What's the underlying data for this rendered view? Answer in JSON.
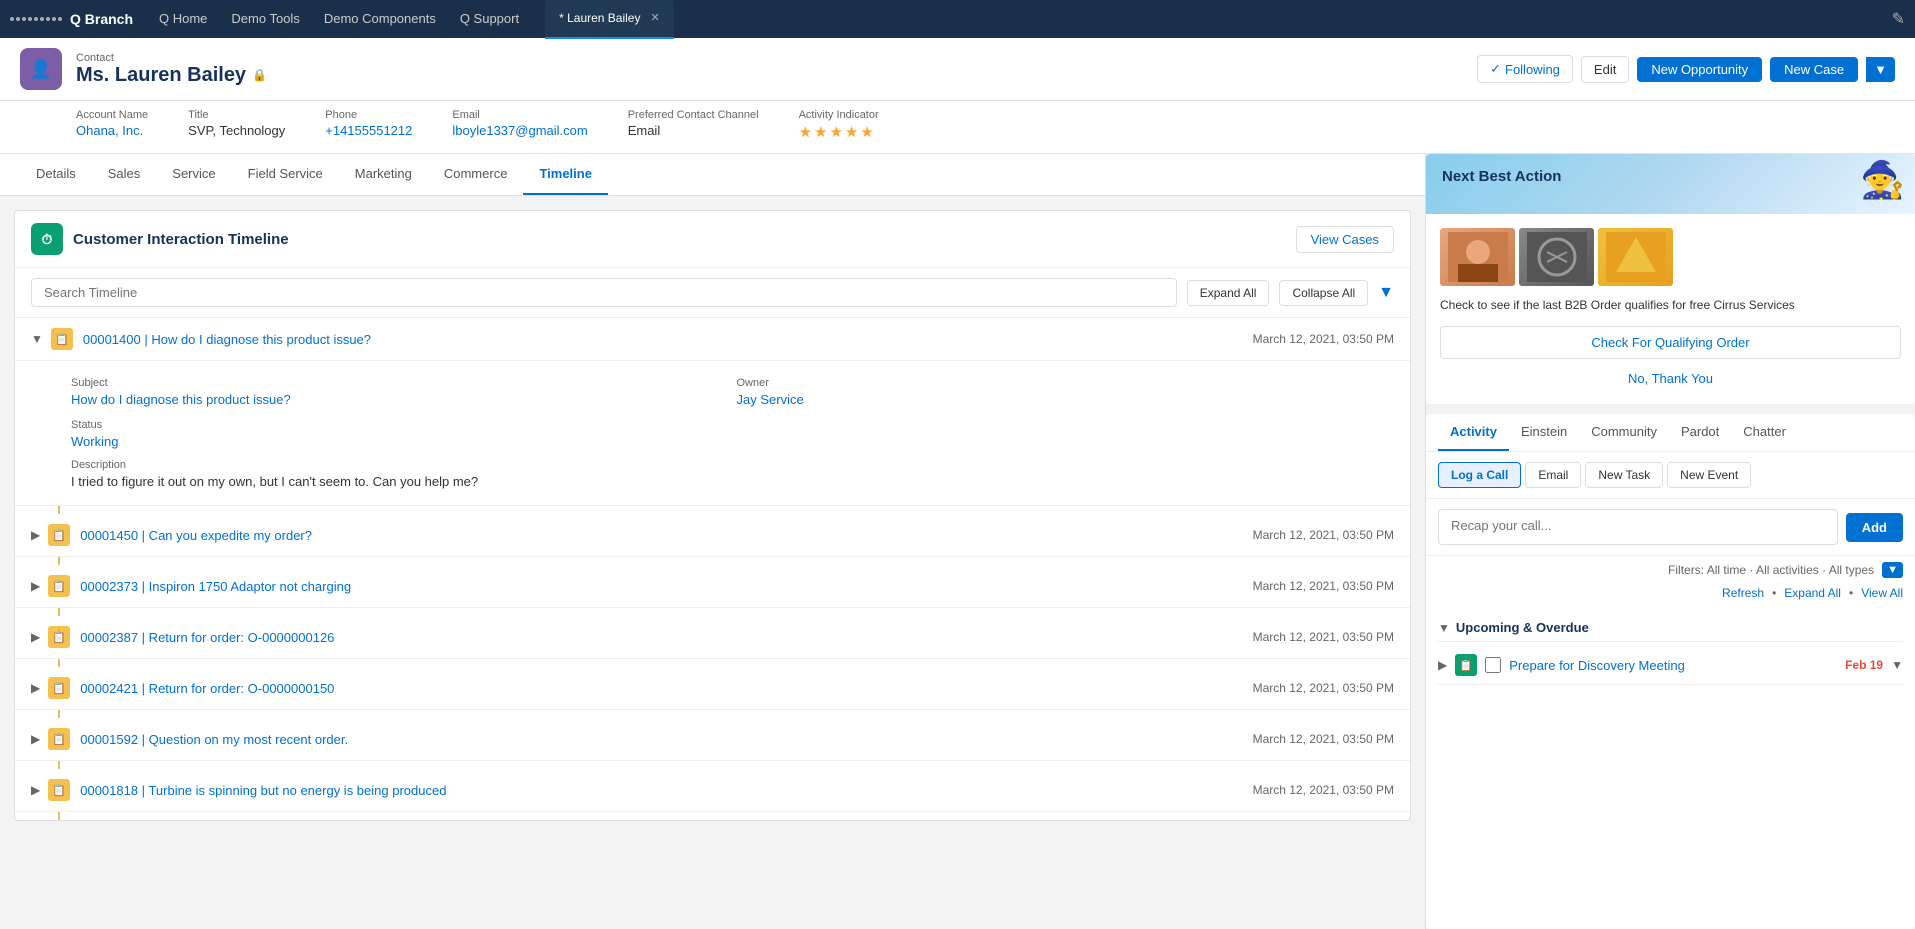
{
  "topNav": {
    "appName": "Q Branch",
    "links": [
      "Q Home",
      "Demo Tools",
      "Demo Components",
      "Q Support"
    ],
    "activeTab": "* Lauren Bailey",
    "tabs": [
      {
        "label": "* Lauren Bailey",
        "active": true
      }
    ]
  },
  "header": {
    "recordType": "Contact",
    "name": "Ms. Lauren Bailey",
    "followLabel": "Following",
    "editLabel": "Edit",
    "newOpportunityLabel": "New Opportunity",
    "newCaseLabel": "New Case"
  },
  "subheader": {
    "accountNameLabel": "Account Name",
    "accountNameValue": "Ohana, Inc.",
    "titleLabel": "Title",
    "titleValue": "SVP, Technology",
    "phoneLabel": "Phone",
    "phoneValue": "+14155551212",
    "emailLabel": "Email",
    "emailValue": "lboyle1337@gmail.com",
    "preferredContactLabel": "Preferred Contact Channel",
    "preferredContactValue": "Email",
    "activityIndicatorLabel": "Activity Indicator",
    "stars": "★★★★★"
  },
  "tabs": {
    "items": [
      "Details",
      "Sales",
      "Service",
      "Field Service",
      "Marketing",
      "Commerce",
      "Timeline"
    ],
    "activeIndex": 6
  },
  "timeline": {
    "title": "Customer Interaction Timeline",
    "viewCasesLabel": "View Cases",
    "searchPlaceholder": "Search Timeline",
    "expandAllLabel": "Expand All",
    "collapseAllLabel": "Collapse All",
    "cases": [
      {
        "id": "00001400",
        "title": "How do I diagnose this product issue?",
        "date": "March 12, 2021, 03:50 PM",
        "expanded": true,
        "subject": "How do I diagnose this product issue?",
        "owner": "Jay Service",
        "status": "Working",
        "description": "I tried to figure it out on my own, but I can't seem to. Can you help me?"
      },
      {
        "id": "00001450",
        "title": "Can you expedite my order?",
        "date": "March 12, 2021, 03:50 PM",
        "expanded": false
      },
      {
        "id": "00002373",
        "title": "Inspiron 1750 Adaptor not charging",
        "date": "March 12, 2021, 03:50 PM",
        "expanded": false
      },
      {
        "id": "00002387",
        "title": "Return for order: O-0000000126",
        "date": "March 12, 2021, 03:50 PM",
        "expanded": false
      },
      {
        "id": "00002421",
        "title": "Return for order: O-0000000150",
        "date": "March 12, 2021, 03:50 PM",
        "expanded": false
      },
      {
        "id": "00001592",
        "title": "Question on my most recent order.",
        "date": "March 12, 2021, 03:50 PM",
        "expanded": false
      },
      {
        "id": "00001818",
        "title": "Turbine is spinning but no energy is being produced",
        "date": "March 12, 2021, 03:50 PM",
        "expanded": false
      }
    ]
  },
  "nba": {
    "title": "Next Best Action",
    "description": "Check to see if the last B2B Order qualifies for free Cirrus Services",
    "checkOrderLabel": "Check For Qualifying Order",
    "noThanksLabel": "No, Thank You"
  },
  "activity": {
    "tabs": [
      "Activity",
      "Einstein",
      "Community",
      "Pardot",
      "Chatter"
    ],
    "activeTab": "Activity",
    "subtabs": [
      "Log a Call",
      "Email",
      "New Task",
      "New Event"
    ],
    "activeSubtab": "Log a Call",
    "textareaPlaceholder": "Recap your call...",
    "addLabel": "Add",
    "filters": "Filters: All time · All activities · All types",
    "refreshLabel": "Refresh",
    "expandAllLabel": "Expand All",
    "viewAllLabel": "View All",
    "upcoming": {
      "title": "Upcoming & Overdue",
      "items": [
        {
          "title": "Prepare for Discovery Meeting",
          "date": "Feb 19"
        }
      ]
    }
  }
}
